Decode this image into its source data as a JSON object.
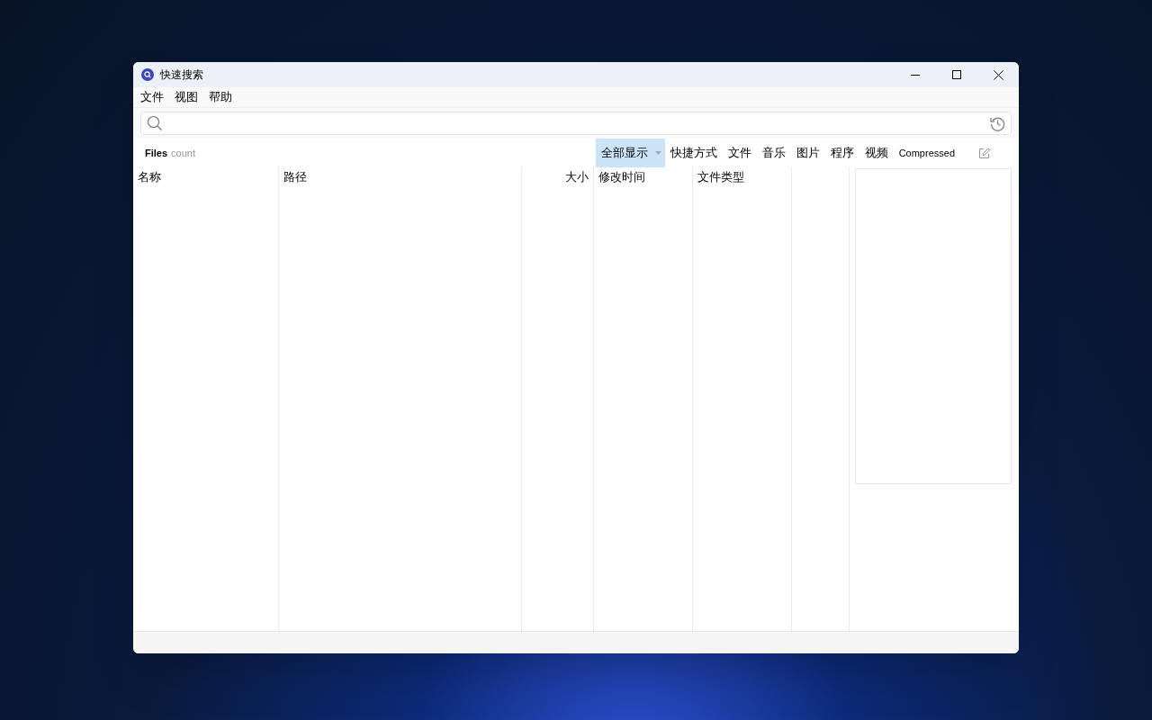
{
  "window": {
    "title": "快速搜索"
  },
  "menu": [
    "文件",
    "视图",
    "帮助"
  ],
  "results": {
    "label": "Files",
    "count": "count"
  },
  "filters": [
    {
      "label": "全部显示",
      "selected": true,
      "dropdown": true
    },
    {
      "label": "快捷方式",
      "selected": false
    },
    {
      "label": "文件",
      "selected": false
    },
    {
      "label": "音乐",
      "selected": false
    },
    {
      "label": "图片",
      "selected": false
    },
    {
      "label": "程序",
      "selected": false
    },
    {
      "label": "视频",
      "selected": false
    },
    {
      "label": "Compressed",
      "selected": false
    }
  ],
  "table": {
    "columns": [
      "名称",
      "路径",
      "大小",
      "修改时间",
      "文件类型"
    ]
  }
}
